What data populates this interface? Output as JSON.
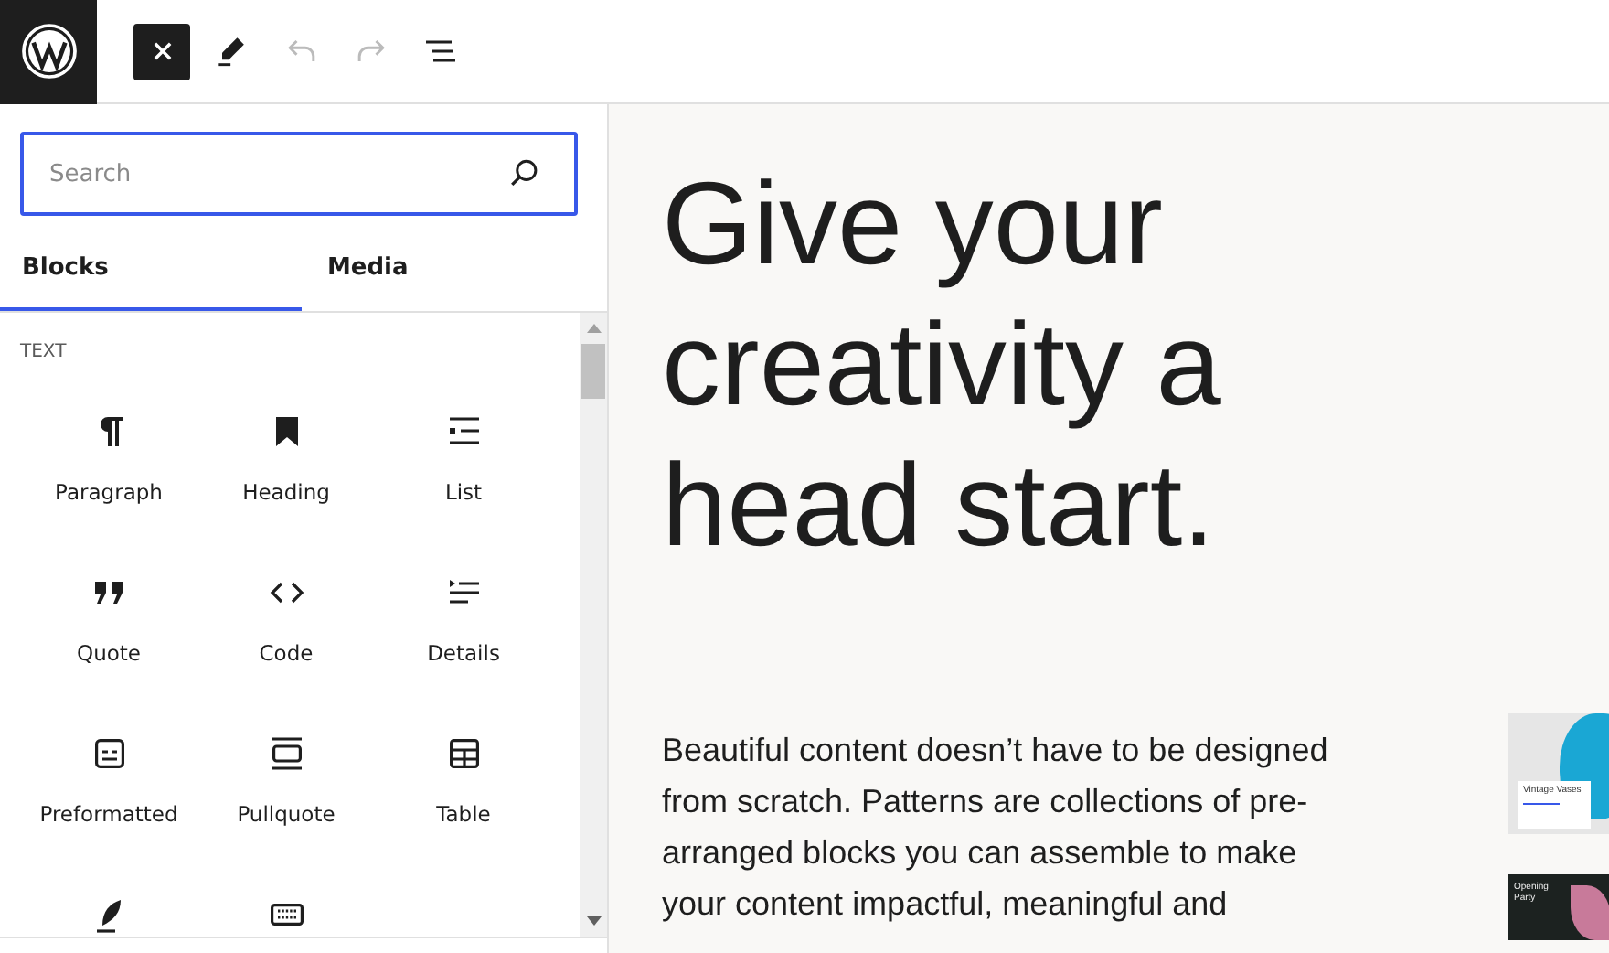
{
  "toolbar": {
    "close_selected": true
  },
  "inserter": {
    "search": {
      "placeholder": "Search"
    },
    "tabs": [
      {
        "label": "Blocks",
        "selected": true
      },
      {
        "label": "Media",
        "selected": false
      }
    ],
    "category": "TEXT",
    "blocks": [
      {
        "label": "Paragraph"
      },
      {
        "label": "Heading"
      },
      {
        "label": "List"
      },
      {
        "label": "Quote"
      },
      {
        "label": "Code"
      },
      {
        "label": "Details"
      },
      {
        "label": "Preformatted"
      },
      {
        "label": "Pullquote"
      },
      {
        "label": "Table"
      },
      {
        "kind": "cut"
      },
      {
        "kind": "cut"
      }
    ]
  },
  "canvas": {
    "heading": "Give your creativity a head start.",
    "paragraph": "Beautiful content doesn’t have to be designed from scratch. Patterns are collections of pre-arranged blocks you can assemble to make your content impactful, meaningful and",
    "previews": [
      {
        "title": "Vintage Vases"
      },
      {
        "title": "Opening Party"
      }
    ]
  }
}
